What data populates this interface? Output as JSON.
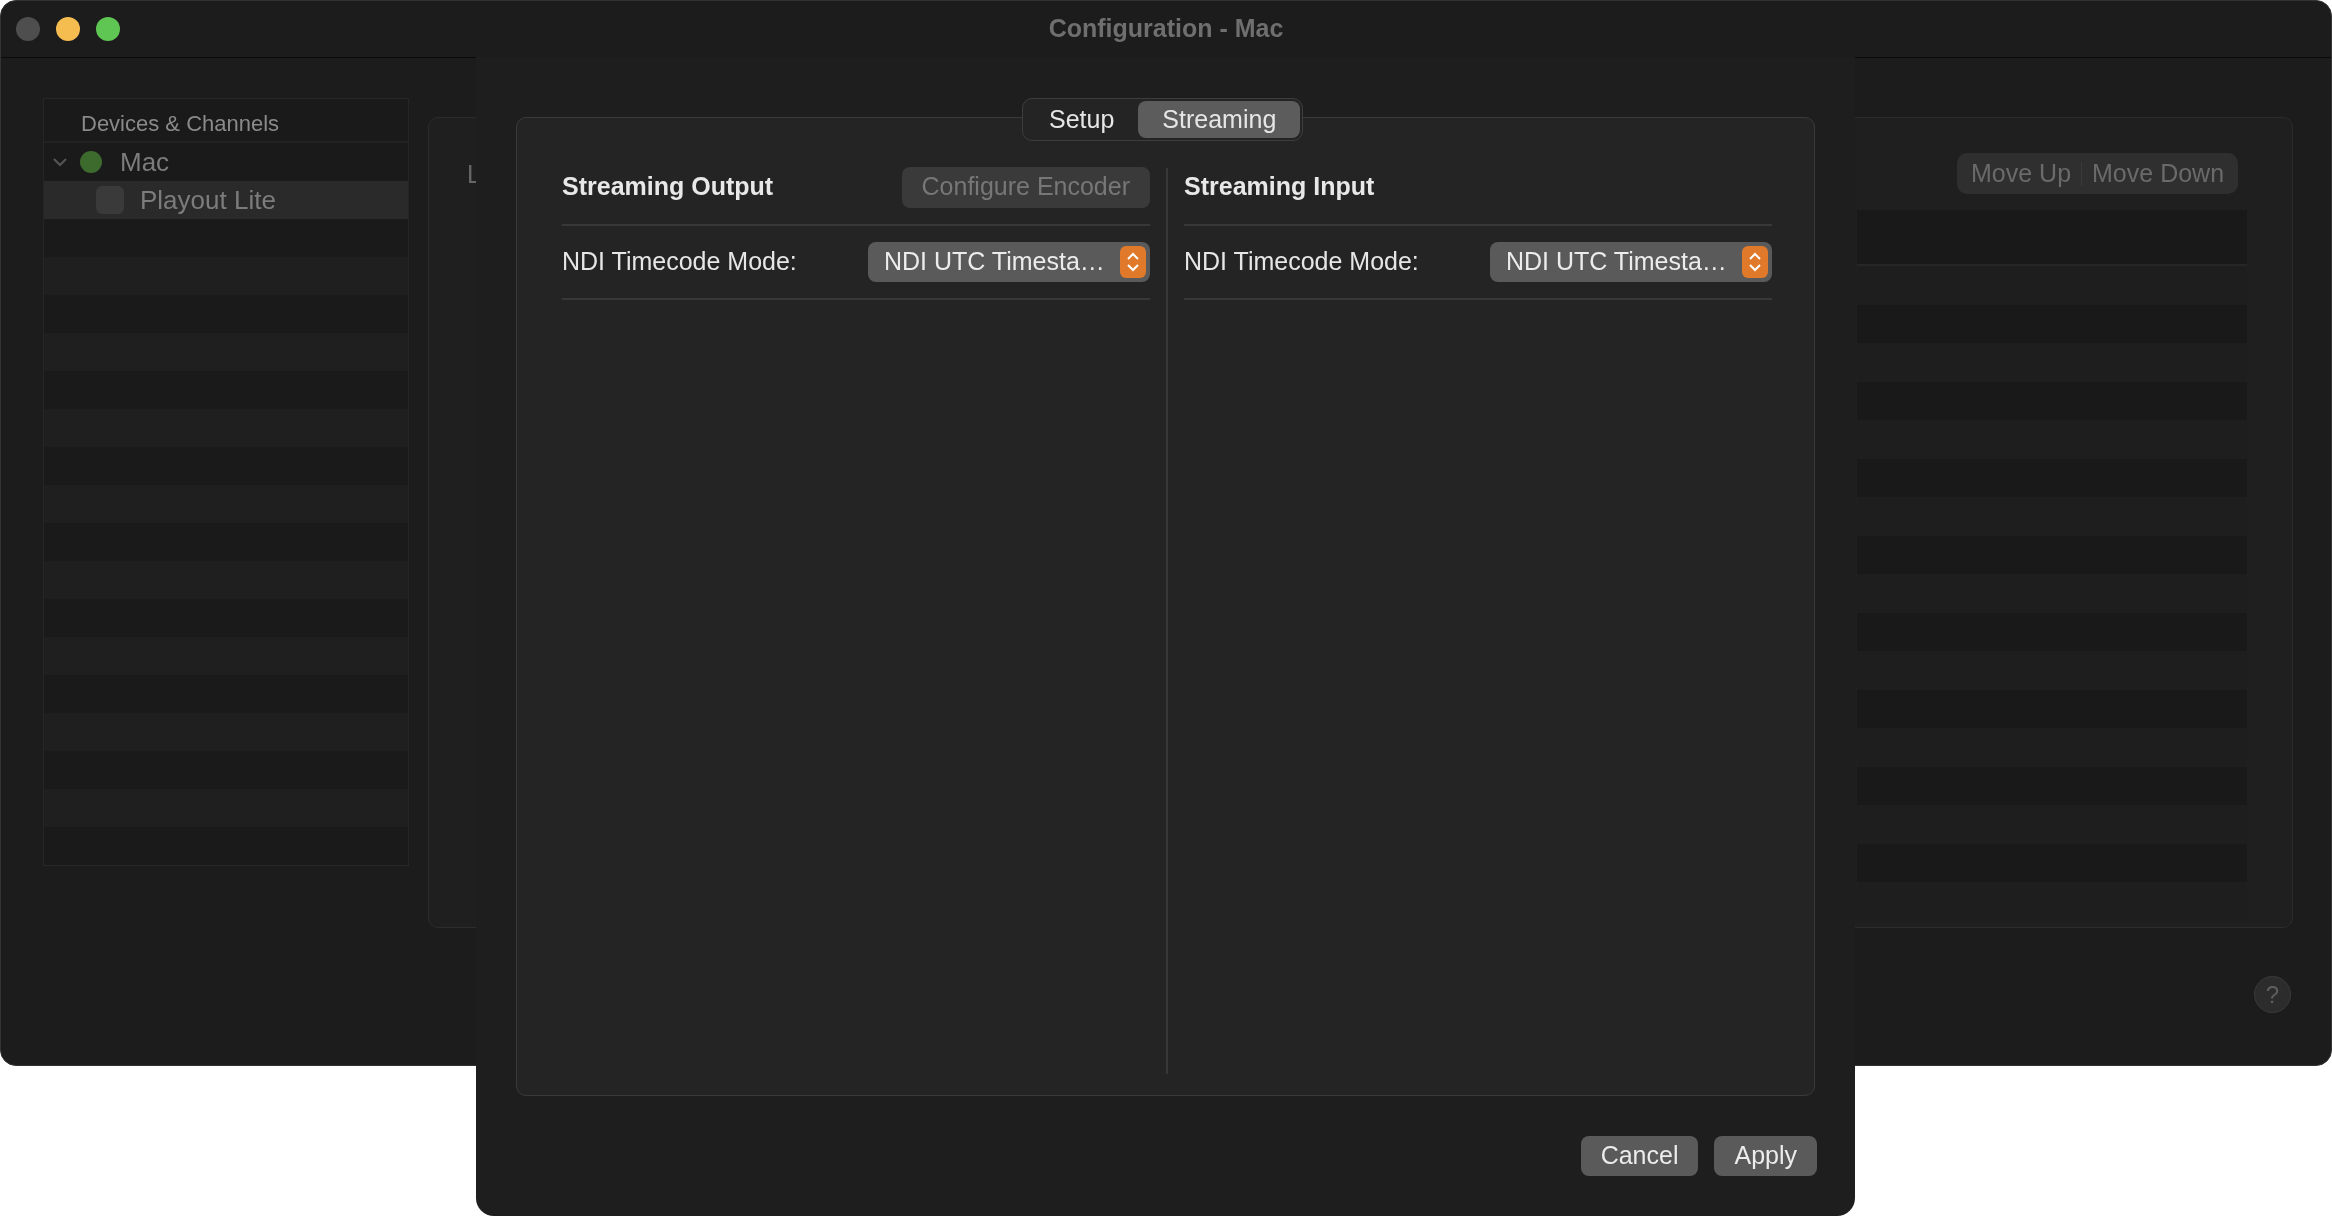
{
  "window": {
    "title": "Configuration - Mac"
  },
  "sidebar": {
    "header": "Devices & Channels",
    "items": [
      {
        "label": "Mac",
        "expanded": true,
        "selected": false,
        "children": [
          {
            "label": "Playout Lite",
            "selected": true,
            "checked": false
          }
        ]
      }
    ]
  },
  "background_panel": {
    "label_fragment": "L",
    "buttons": [
      {
        "label": "Move Up",
        "disabled": true
      },
      {
        "label": "Move Down",
        "disabled": true
      }
    ]
  },
  "help_button": "?",
  "dialog": {
    "tabs": [
      {
        "label": "Setup",
        "selected": false
      },
      {
        "label": "Streaming",
        "selected": true
      }
    ],
    "sections": [
      {
        "title": "Streaming Output",
        "button": {
          "label": "Configure Encoder",
          "disabled": true
        },
        "fields": [
          {
            "label": "NDI Timecode Mode:",
            "value": "NDI UTC Timesta…"
          }
        ]
      },
      {
        "title": "Streaming Input",
        "fields": [
          {
            "label": "NDI Timecode Mode:",
            "value": "NDI UTC Timesta…"
          }
        ]
      }
    ],
    "buttons": [
      "Cancel",
      "Apply"
    ]
  }
}
